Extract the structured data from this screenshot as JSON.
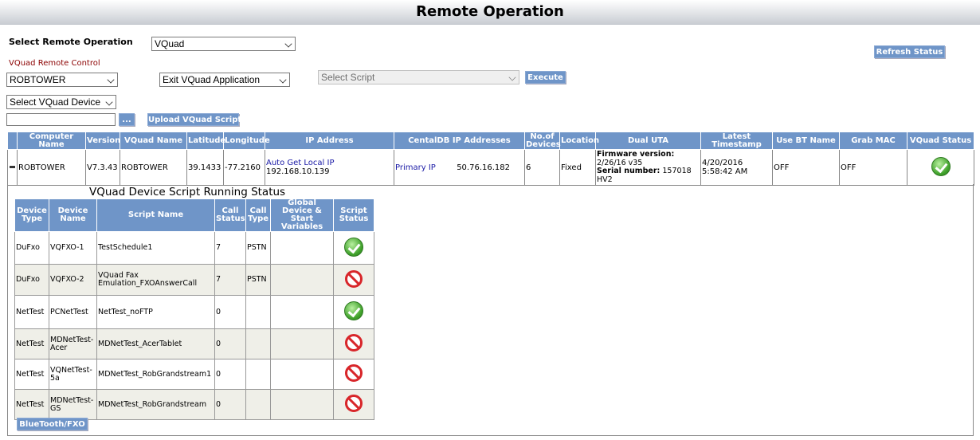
{
  "page": {
    "title": "Remote Operation"
  },
  "controls": {
    "select_operation_label": "Select Remote Operation",
    "operation_value": "VQuad",
    "remote_control_label": "VQuad Remote Control",
    "tower_value": "ROBTOWER",
    "action_value": "Exit VQuad Application",
    "script_value": "Select Script",
    "execute_label": "Execute",
    "refresh_label": "Refresh Status",
    "device_value": "Select VQuad Device",
    "file_input_value": "",
    "browse_label": "...",
    "upload_label": "Upload VQuad Script"
  },
  "device_table": {
    "headers": {
      "computer_name": "Computer Name",
      "version": "Version",
      "vquad_name": "VQuad Name",
      "latitude": "Latitude",
      "longitude": "Longitude",
      "ip_address": "IP Address",
      "centaldb_ips": "CentalDB IP Addresses",
      "no_of_devices": "No.of Devices",
      "location": "Location",
      "dual_uta": "Dual UTA",
      "latest_timestamp": "Latest Timestamp",
      "use_bt_name": "Use BT Name",
      "grab_mac": "Grab MAC",
      "vquad_status": "VQuad Status"
    },
    "row": {
      "computer_name": "ROBTOWER",
      "version": "V7.3.43",
      "vquad_name": "ROBTOWER",
      "latitude": "39.1433",
      "longitude": "-77.2160",
      "ip_link": "Auto Get Local IP",
      "ip_value": "192.168.10.139",
      "primary_ip_label": "Primary IP",
      "primary_ip_value": "50.76.16.182",
      "no_of_devices": "6",
      "location": "Fixed",
      "firmware_label": "Firmware version:",
      "firmware_value": "2/26/16 v35",
      "serial_label": "Serial number:",
      "serial_value": "157018",
      "hw_value": "HV2",
      "timestamp": "4/20/2016 5:58:42 AM",
      "use_bt_name": "OFF",
      "grab_mac": "OFF",
      "status": "ok"
    }
  },
  "script_status": {
    "title": "VQuad Device Script Running Status",
    "headers": {
      "device_type": "Device Type",
      "device_name": "Device Name",
      "script_name": "Script Name",
      "call_status": "Call Status",
      "call_type": "Call Type",
      "global_vars": "Global Device & Start Variables",
      "script_status": "Script Status"
    },
    "rows": [
      {
        "device_type": "DuFxo",
        "device_name": "VQFXO-1",
        "script_name": "TestSchedule1",
        "call_status": "7",
        "call_type": "PSTN",
        "global_vars": "",
        "status": "ok"
      },
      {
        "device_type": "DuFxo",
        "device_name": "VQFXO-2",
        "script_name": "VQuad Fax Emulation_FXOAnswerCall",
        "call_status": "7",
        "call_type": "PSTN",
        "global_vars": "",
        "status": "stopped"
      },
      {
        "device_type": "NetTest",
        "device_name": "PCNetTest",
        "script_name": "NetTest_noFTP",
        "call_status": "0",
        "call_type": "",
        "global_vars": "",
        "status": "ok"
      },
      {
        "device_type": "NetTest",
        "device_name": "MDNetTest-Acer",
        "script_name": "MDNetTest_AcerTablet",
        "call_status": "0",
        "call_type": "",
        "global_vars": "",
        "status": "stopped"
      },
      {
        "device_type": "NetTest",
        "device_name": "VQNetTest-5a",
        "script_name": "MDNetTest_RobGrandstream1",
        "call_status": "0",
        "call_type": "",
        "global_vars": "",
        "status": "stopped"
      },
      {
        "device_type": "NetTest",
        "device_name": "MDNetTest-GS",
        "script_name": "MDNetTest_RobGrandstream",
        "call_status": "0",
        "call_type": "",
        "global_vars": "",
        "status": "stopped"
      }
    ],
    "bluetooth_label": "BlueTooth/FXO"
  },
  "colors": {
    "header_blue": "#6f95c8",
    "link_blue": "#1a1aa6",
    "label_red": "#8b0000",
    "ok_green": "#3fa12a",
    "stop_red": "#d8262a"
  }
}
